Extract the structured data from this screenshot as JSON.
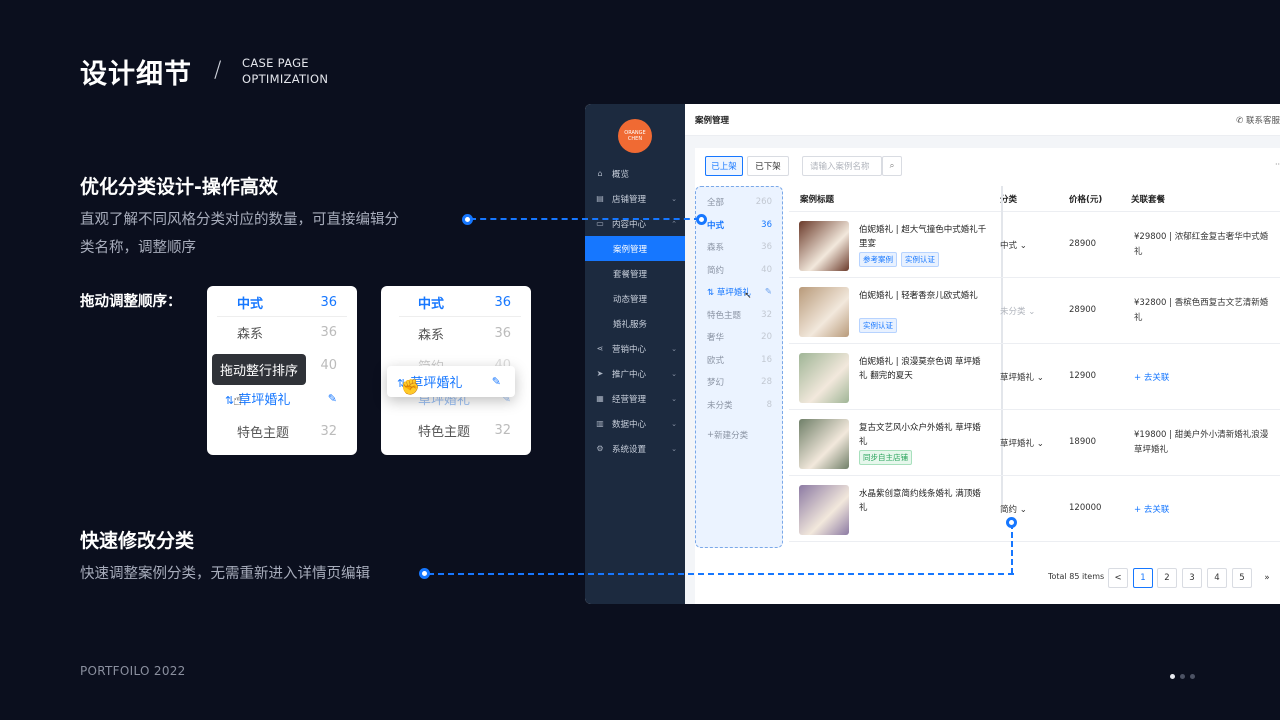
{
  "header": {
    "title": "设计细节",
    "slash": "/",
    "subtitle_line1": "CASE PAGE",
    "subtitle_line2": "OPTIMIZATION"
  },
  "section1": {
    "title": "优化分类设计-操作高效",
    "desc_line1": "直观了解不同风格分类对应的数量，可直接编辑分",
    "desc_line2": "类名称，调整顺序"
  },
  "drag": {
    "label": "拖动调整顺序：",
    "tooltip": "拖动整行排序",
    "card1": [
      {
        "name": "中式",
        "count": "36"
      },
      {
        "name": "森系",
        "count": "36"
      },
      {
        "name": "简约",
        "count": "40"
      },
      {
        "name": "草坪婚礼",
        "count": ""
      },
      {
        "name": "特色主题",
        "count": "32"
      }
    ],
    "card2": [
      {
        "name": "中式",
        "count": "36"
      },
      {
        "name": "森系",
        "count": "36"
      },
      {
        "name": "简约",
        "count": "40"
      },
      {
        "name": "草坪婚礼",
        "count": ""
      },
      {
        "name": "特色主题",
        "count": "32"
      }
    ],
    "dragging": "草坪婚礼"
  },
  "section2": {
    "title": "快速修改分类",
    "desc": "快速调整案例分类，无需重新进入详情页编辑"
  },
  "footer": "PORTFOILO 2022",
  "app": {
    "logo_text": "ORANGE CHEN",
    "sidebar": [
      {
        "label": "概览",
        "icon": "home-icon",
        "chev": ""
      },
      {
        "label": "店铺管理",
        "icon": "store-icon",
        "chev": "⌄"
      },
      {
        "label": "内容中心",
        "icon": "folder-icon",
        "chev": "⌃"
      },
      {
        "label": "案例管理",
        "icon": "",
        "chev": "",
        "active": true
      },
      {
        "label": "套餐管理",
        "icon": "",
        "chev": ""
      },
      {
        "label": "动态管理",
        "icon": "",
        "chev": ""
      },
      {
        "label": "婚礼服务",
        "icon": "",
        "chev": ""
      },
      {
        "label": "营销中心",
        "icon": "share-icon",
        "chev": "⌄"
      },
      {
        "label": "推广中心",
        "icon": "send-icon",
        "chev": "⌄"
      },
      {
        "label": "经营管理",
        "icon": "calendar-icon",
        "chev": "⌄"
      },
      {
        "label": "数据中心",
        "icon": "bar-chart-icon",
        "chev": "⌄"
      },
      {
        "label": "系统设置",
        "icon": "gear-icon",
        "chev": "⌄"
      }
    ],
    "page_title": "案例管理",
    "contact": "联系客服",
    "tabs": [
      "已上架",
      "已下架"
    ],
    "search_placeholder": "请输入案例名称",
    "more": "···",
    "categories": [
      {
        "name": "全部",
        "count": "260"
      },
      {
        "name": "中式",
        "count": "36"
      },
      {
        "name": "森系",
        "count": "36"
      },
      {
        "name": "简约",
        "count": "40"
      },
      {
        "name": "草坪婚礼",
        "count": ""
      },
      {
        "name": "特色主题",
        "count": "32"
      },
      {
        "name": "奢华",
        "count": "20"
      },
      {
        "name": "欧式",
        "count": "16"
      },
      {
        "name": "梦幻",
        "count": "28"
      },
      {
        "name": "未分类",
        "count": "8"
      }
    ],
    "add_category": "新建分类",
    "columns": {
      "title": "案例标题",
      "category": "分类",
      "price": "价格(元)",
      "package": "关联套餐"
    },
    "rows": [
      {
        "title": "伯妮婚礼 | 超大气撞色中式婚礼千里宴",
        "tags": [
          "参考案例",
          "实例认证"
        ],
        "tag_style": "blue",
        "category": "中式",
        "price": "28900",
        "package": "¥29800 | 浓郁红金复古奢华中式婚礼",
        "thumb": "#6b3a2a"
      },
      {
        "title": "伯妮婚礼 | 轻奢香奈儿欧式婚礼",
        "tags": [
          "实例认证"
        ],
        "tag_style": "blue",
        "category": "未分类",
        "price": "28900",
        "package": "¥32800 | 香槟色西复古文艺清新婚礼",
        "thumb": "#b89a7a"
      },
      {
        "title": "伯妮婚礼 | 浪漫莫奈色调 草坪婚礼 翻完的夏天",
        "tags": [],
        "tag_style": "",
        "category": "草坪婚礼",
        "price": "12900",
        "package": "",
        "link": "+ 去关联",
        "thumb": "#9fb596"
      },
      {
        "title": "复古文艺风小众户外婚礼 草坪婚礼",
        "tags": [
          "同步自主店铺"
        ],
        "tag_style": "green",
        "category": "草坪婚礼",
        "price": "18900",
        "package": "¥19800 | 甜美户外小清新婚礼浪漫草坪婚礼",
        "thumb": "#6f7f68"
      },
      {
        "title": "水晶紫创意简约线条婚礼 满顶婚礼",
        "tags": [],
        "tag_style": "",
        "category": "简约",
        "price": "120000",
        "package": "",
        "link": "+ 去关联",
        "thumb": "#8c7aa3"
      }
    ],
    "pagination": {
      "total": "Total 85 items",
      "pages": [
        "1",
        "2",
        "3",
        "4",
        "5"
      ],
      "current": "1",
      "prev": "<",
      "next": "»"
    }
  },
  "colors": {
    "accent": "#1677ff",
    "bg": "#0b0f1e",
    "sidebar": "#1c2a3f",
    "logo": "#f06a33"
  }
}
